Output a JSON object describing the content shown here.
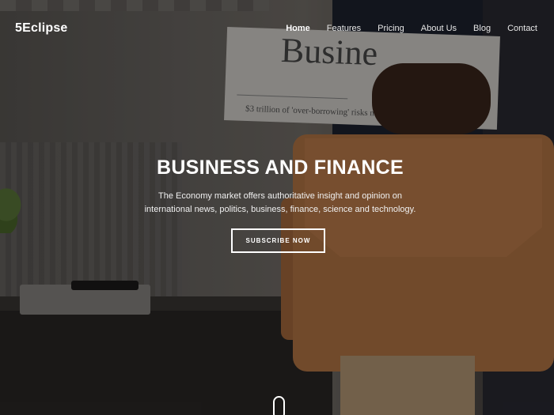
{
  "header": {
    "logo": "5Eclipse",
    "nav": [
      "Home",
      "Features",
      "Pricing",
      "About Us",
      "Blog",
      "Contact"
    ]
  },
  "hero": {
    "headline": "BUSINESS AND FINANCE",
    "subline1": "The Economy market offers authoritative insight and opinion on",
    "subline2": "international news, politics, business, finance, science and technology.",
    "cta": "SUBSCRIBE NOW"
  },
  "photo": {
    "newspaper_title": "Busine",
    "newspaper_headline": "$3 trillion of 'over-borrowing' risks new glo"
  },
  "colors": {
    "accent": "#ffffff",
    "overlay": "#000000"
  }
}
